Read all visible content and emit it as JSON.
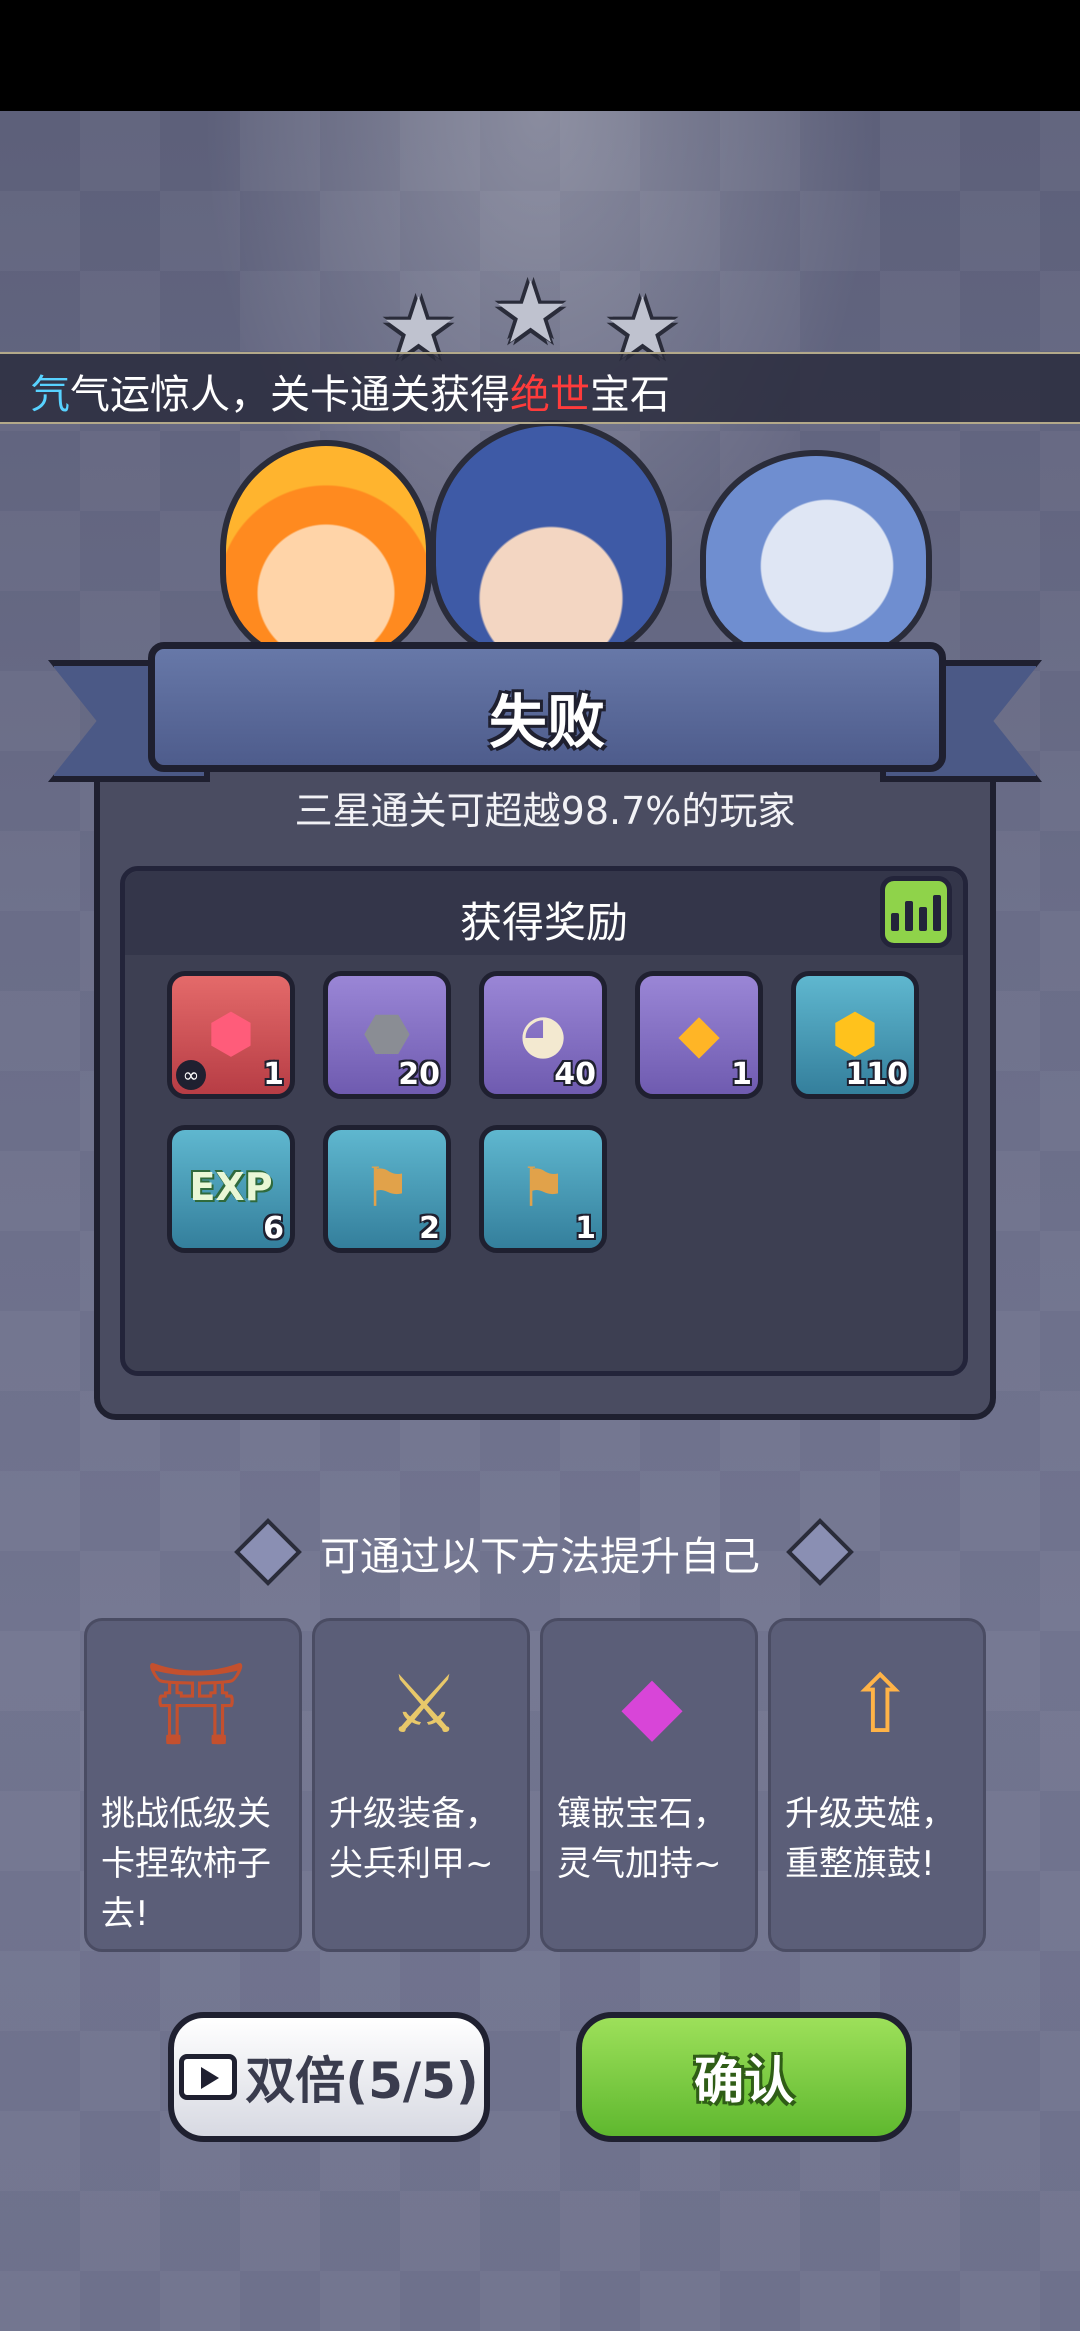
{
  "ticker": {
    "prefix": "氕",
    "text_before": "气运惊人，关卡通关获得",
    "highlight": "绝世",
    "text_after": "宝石"
  },
  "stars": {
    "earned": 0,
    "total": 3
  },
  "banner": {
    "title": "失败"
  },
  "subtitle": "三星通关可超越98.7%的玩家",
  "rewards": {
    "title": "获得奖励",
    "items": [
      {
        "icon": "ruby-gem-icon",
        "count": "1",
        "rarity": "red"
      },
      {
        "icon": "rock-golem-hero-icon",
        "count": "20",
        "rarity": "purple"
      },
      {
        "icon": "panda-hero-icon",
        "count": "40",
        "rarity": "purple"
      },
      {
        "icon": "amber-crystal-icon",
        "count": "1",
        "rarity": "purple"
      },
      {
        "icon": "gold-coin-icon",
        "count": "110",
        "rarity": "blue"
      },
      {
        "icon": "exp-icon",
        "count": "6",
        "rarity": "blue",
        "label": "EXP"
      },
      {
        "icon": "armor-scroll-icon",
        "count": "2",
        "rarity": "blue"
      },
      {
        "icon": "necklace-scroll-icon",
        "count": "1",
        "rarity": "blue"
      }
    ]
  },
  "tips": {
    "title": "可通过以下方法提升自己",
    "cards": [
      {
        "icon": "shrine-icon",
        "text": "挑战低级关卡捏软柿子去!"
      },
      {
        "icon": "sword-icon",
        "text": "升级装备，尖兵利甲~"
      },
      {
        "icon": "gems-icon",
        "text": "镶嵌宝石，灵气加持~"
      },
      {
        "icon": "heroes-upgrade-icon",
        "text": "升级英雄，重整旗鼓!"
      }
    ]
  },
  "buttons": {
    "double": "双倍(5/5)",
    "confirm": "确认"
  },
  "colors": {
    "highlight": "#ff3b3b",
    "confirm": "#7ccc44",
    "banner": "#5a6898"
  }
}
